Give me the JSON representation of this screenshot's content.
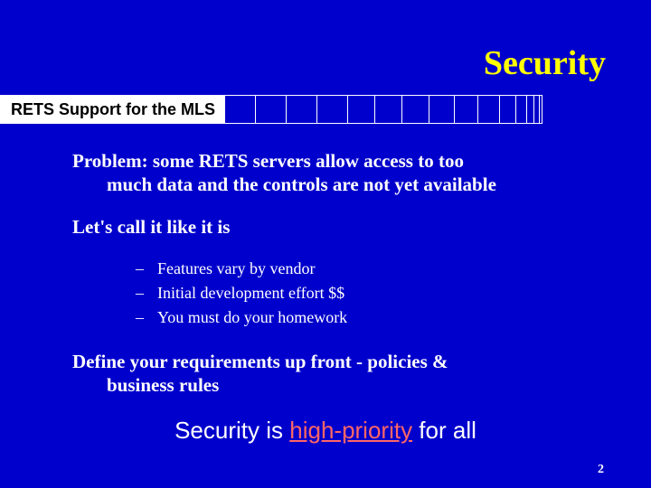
{
  "title": "Security",
  "header_label": "RETS Support for the MLS",
  "problem_line1": "Problem:  some RETS servers allow access to too",
  "problem_line2": "much data and the controls are not yet available",
  "callit": "Let's call it like it is",
  "bullets": [
    "Features vary by vendor",
    "Initial development effort $$",
    "You must do your homework"
  ],
  "define": "Define your requirements up front - policies &",
  "define2": "business rules",
  "footer_pre": "Security is ",
  "footer_hp": "high-priority",
  "footer_post": " for all",
  "page": "2"
}
